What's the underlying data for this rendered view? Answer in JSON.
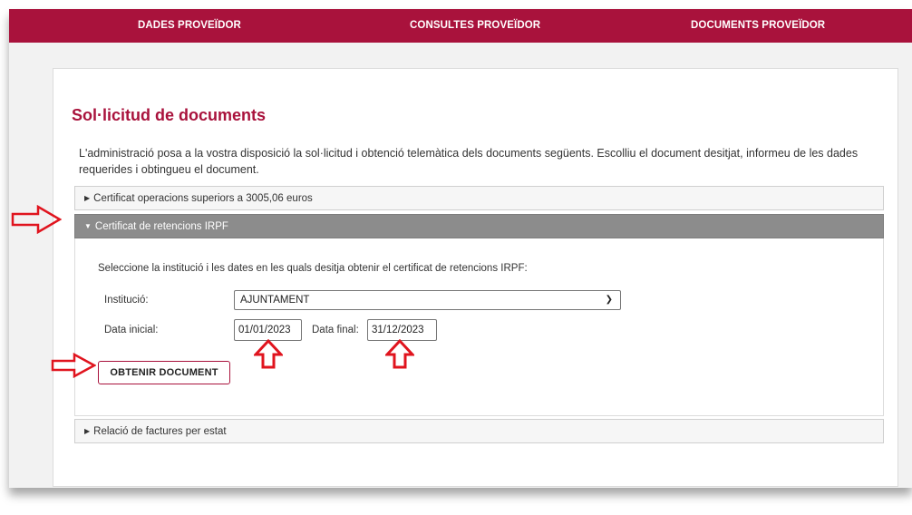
{
  "nav": {
    "items": [
      "DADES PROVEÏDOR",
      "CONSULTES PROVEÏDOR",
      "DOCUMENTS PROVEÏDOR"
    ]
  },
  "page": {
    "title": "Sol·licitud de documents",
    "intro": "L'administració posa a la vostra disposició la sol·licitud i obtenció telemàtica dels documents següents. Escolliu el document desitjat, informeu de les dades requerides i obtingueu el document."
  },
  "accordion": {
    "item1": "Certificat operacions superiors a 3005,06 euros",
    "item2": "Certificat de retencions IRPF",
    "item3": "Relació de factures per estat"
  },
  "form": {
    "instruction": "Seleccione la institució i les dates en les quals desitja obtenir el certificat de retencions IRPF:",
    "institucio_label": "Institució:",
    "institucio_value": "AJUNTAMENT",
    "data_inicial_label": "Data inicial:",
    "data_inicial_value": "01/01/2023",
    "data_final_label": "Data final:",
    "data_final_value": "31/12/2023",
    "button_label": "OBTENIR DOCUMENT"
  },
  "colors": {
    "brand": "#a9123c",
    "active_header": "#8c8c8c",
    "annotation": "#e0141e"
  }
}
